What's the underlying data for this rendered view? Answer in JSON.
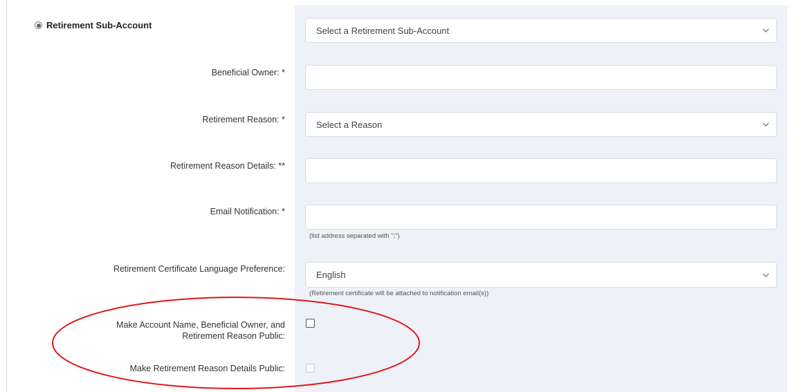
{
  "section": {
    "radio_label": "Retirement Sub-Account"
  },
  "sub_account": {
    "value": "Select a Retirement Sub-Account"
  },
  "beneficial_owner": {
    "label": "Beneficial Owner: *",
    "value": ""
  },
  "reason": {
    "label": "Retirement Reason: *",
    "value": "Select a Reason"
  },
  "reason_details": {
    "label": "Retirement Reason Details: **",
    "value": ""
  },
  "email": {
    "label": "Email Notification: *",
    "value": "",
    "hint": "(list address separated with \";\")"
  },
  "language": {
    "label": "Retirement Certificate Language Preference:",
    "value": "English",
    "hint": "(Retirement certificate will be attached to notification email(s))"
  },
  "public_name": {
    "label_line1": "Make Account Name, Beneficial Owner, and",
    "label_line2": "Retirement Reason Public:",
    "checked": false
  },
  "public_details": {
    "label": "Make Retirement Reason Details Public:",
    "checked": false,
    "disabled": true
  },
  "colors": {
    "panel": "#eef1f7",
    "annotation": "#e0161b"
  }
}
